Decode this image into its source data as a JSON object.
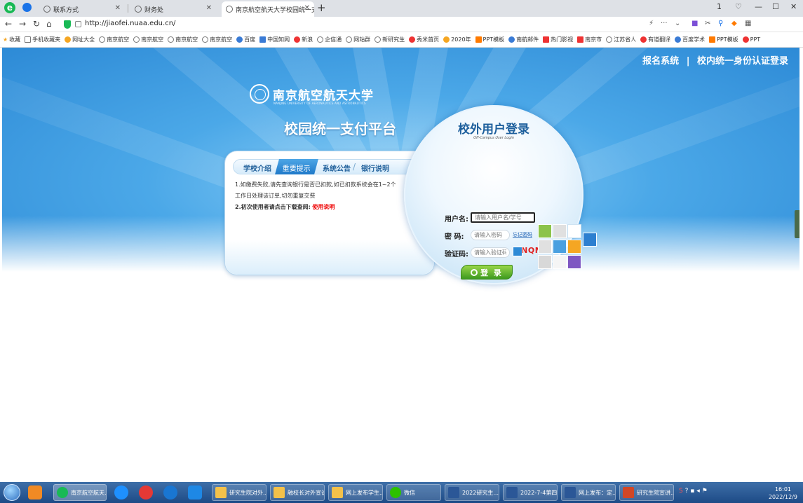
{
  "browser": {
    "tabs": [
      {
        "label": "联系方式",
        "active": false
      },
      {
        "label": "财务处",
        "active": false
      },
      {
        "label": "南京航空航天大学校园统一支",
        "active": true
      }
    ],
    "new_tab": "+",
    "url": "http://jiaofei.nuaa.edu.cn/",
    "window_controls": [
      "1",
      "—",
      "☐",
      "✕"
    ],
    "bookmarks": [
      {
        "label": "收藏",
        "icon": "star-icon"
      },
      {
        "label": "手机收藏夹",
        "icon": "phone-icon"
      },
      {
        "label": "网址大全",
        "icon": "globe-icon"
      },
      {
        "label": "南京航空",
        "icon": "globe-icon"
      },
      {
        "label": "南京航空",
        "icon": "globe-icon"
      },
      {
        "label": "南京航空",
        "icon": "globe-icon"
      },
      {
        "label": "南京航空",
        "icon": "globe-icon"
      },
      {
        "label": "百度",
        "icon": "baidu-icon"
      },
      {
        "label": "中国知网",
        "icon": "cnki-icon"
      },
      {
        "label": "新浪",
        "icon": "weibo-icon"
      },
      {
        "label": "企信通",
        "icon": "globe-icon"
      },
      {
        "label": "网站群",
        "icon": "globe-icon"
      },
      {
        "label": "新研究生",
        "icon": "globe-icon"
      },
      {
        "label": "秀米首页",
        "icon": "xiumi-icon"
      },
      {
        "label": "2020年",
        "icon": "globe-icon"
      },
      {
        "label": "PPT模板",
        "icon": "ppt-icon"
      },
      {
        "label": "南航邮件",
        "icon": "mail-icon"
      },
      {
        "label": "热门影视",
        "icon": "video-icon"
      },
      {
        "label": "南京市",
        "icon": "globe-icon"
      },
      {
        "label": "江苏省人",
        "icon": "globe-icon"
      },
      {
        "label": "有道翻译",
        "icon": "youdao-icon"
      },
      {
        "label": "百度学术",
        "icon": "baidu-icon"
      },
      {
        "label": "PPT模板",
        "icon": "ppt-icon"
      },
      {
        "label": "PPT",
        "icon": "ppt-icon"
      }
    ]
  },
  "page": {
    "top_links": [
      "报名系统",
      "|",
      "校内统一身份认证登录"
    ],
    "university_name": "南京航空航天大学",
    "university_en": "NANJING UNIVERSITY OF AERONAUTICS AND ASTRONAUTICS",
    "platform_title": "校园统一支付平台",
    "info_tabs": [
      {
        "label": "学校介绍",
        "active": false
      },
      {
        "label": "重要提示",
        "active": true
      },
      {
        "label": "系统公告",
        "active": false
      },
      {
        "label": "银行说明",
        "active": false
      }
    ],
    "tab_separator": "/",
    "notice": {
      "line1": "1.如缴费失败,请先查询银行是否已扣款,如已扣款系统会在1~2个",
      "line2": "工作日处理该订单,切勿重复交费",
      "line3_prefix": "2.初次使用者请点击下载查阅:",
      "line3_link": "使用说明"
    },
    "login": {
      "title": "校外用户登录",
      "subtitle": "Off-Campus User Login",
      "username_label": "用户名:",
      "username_placeholder": "请输入用户名/学号",
      "password_label": "密  码:",
      "password_placeholder": "请输入密码",
      "forgot_label": "忘记密码",
      "captcha_label": "验证码:",
      "captcha_placeholder": "请输入验证码",
      "captcha_code": "8NQM",
      "submit_label": "登 录"
    }
  },
  "taskbar": {
    "tasks": [
      {
        "label": "南京航空航天...",
        "color": "#19b955"
      },
      {
        "label": "研究生院对外...",
        "color": "#f3c14a"
      },
      {
        "label": "融校长对外宣讲",
        "color": "#f3c14a"
      },
      {
        "label": "网上发布学生...",
        "color": "#f3c14a"
      },
      {
        "label": "微信",
        "color": "#2dc100"
      },
      {
        "label": "2022研究生...",
        "color": "#2b5797"
      },
      {
        "label": "2022-7-4第四...",
        "color": "#2b5797"
      },
      {
        "label": "网上发布：定...",
        "color": "#2b5797"
      },
      {
        "label": "研究生院宣讲...",
        "color": "#d24726"
      }
    ],
    "time": "16:01",
    "date": "2022/12/9"
  },
  "colors": {
    "accent_blue": "#1d5f9c",
    "login_green": "#3d9a1e",
    "captcha_red": "#e02020"
  }
}
